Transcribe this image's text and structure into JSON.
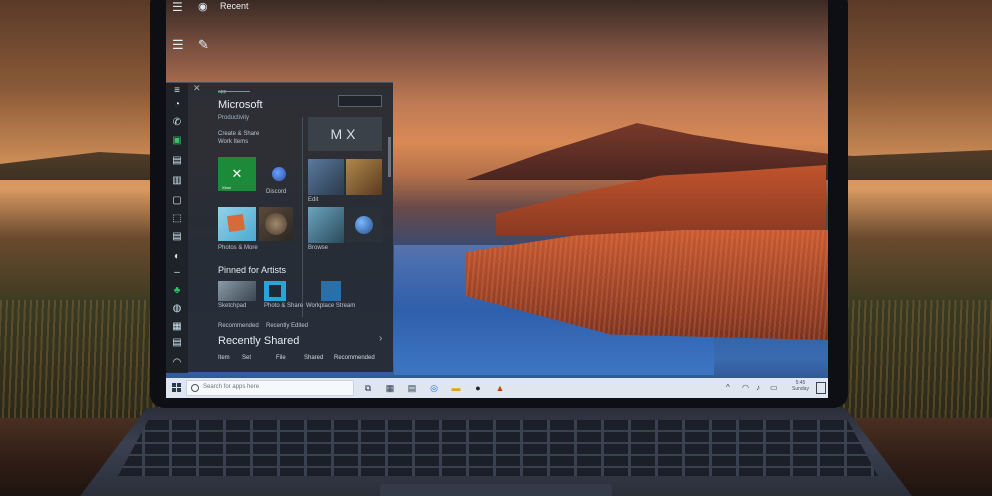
{
  "window": {
    "title": "Recent"
  },
  "start_menu": {
    "tiny_label": "app",
    "heading": "Microsoft",
    "section_label": "Productivity",
    "subtext": [
      "Create & Share",
      "Work Items"
    ],
    "xbox_tile_label": "Xbox",
    "tile_captions": [
      "Discord",
      "Photos & More",
      "Edit",
      "Browse"
    ],
    "mix_tile": "MX",
    "apps_label": "Explore",
    "group_heading": "Pinned for Artists",
    "row_captions": [
      "Sketchpad",
      "Photo & Share",
      "Workplace Stream"
    ],
    "row2_labels": [
      "Recommended",
      "Recently Edited"
    ],
    "big_heading": "Recently Shared",
    "bottom_row": [
      "Item",
      "Set",
      "File",
      "Shared",
      "Recommended"
    ]
  },
  "taskbar": {
    "search_placeholder": "Search for apps here",
    "clock": [
      "5:45",
      "Sunday"
    ]
  },
  "colors": {
    "accent": "#2fb6c9",
    "xbox_green": "#1d8a3a",
    "taskbar_bg": "#dfe6ef"
  },
  "icons": [
    "menu-icon",
    "app-icon",
    "hamburger-icon",
    "pen-icon",
    "windows-icon",
    "search-icon",
    "task-view-icon",
    "edge-icon",
    "store-icon",
    "mail-icon",
    "notification-icon"
  ]
}
